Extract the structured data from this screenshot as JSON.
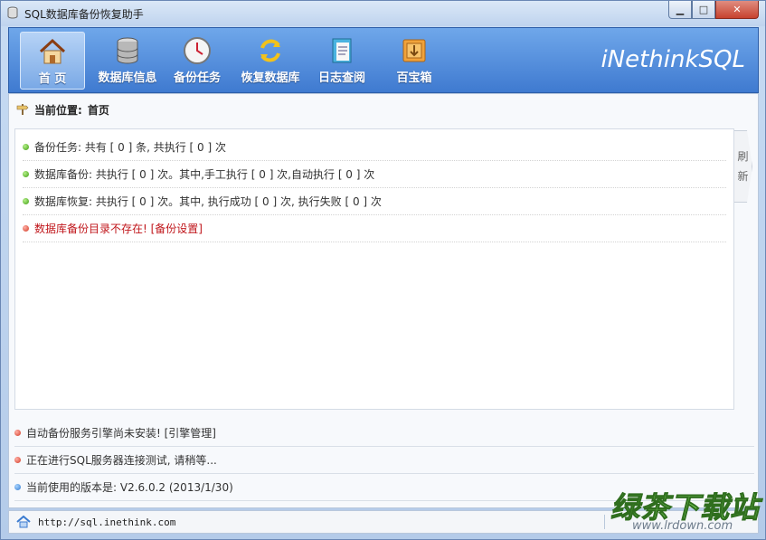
{
  "window": {
    "title": "SQL数据库备份恢复助手",
    "controls": {
      "minimize": "▁",
      "maximize": "□",
      "close": "✕"
    }
  },
  "toolbar": {
    "items": [
      {
        "label": "首 页",
        "icon": "home-icon",
        "active": true
      },
      {
        "label": "数据库信息",
        "icon": "database-icon",
        "active": false
      },
      {
        "label": "备份任务",
        "icon": "clock-icon",
        "active": false
      },
      {
        "label": "恢复数据库",
        "icon": "restore-icon",
        "active": false
      },
      {
        "label": "日志查阅",
        "icon": "log-book-icon",
        "active": false
      },
      {
        "label": "百宝箱",
        "icon": "toolbox-icon",
        "active": false
      }
    ],
    "brand": "iNethinkSQL"
  },
  "breadcrumb": {
    "prefix": "当前位置:",
    "current": "首页"
  },
  "summary": [
    {
      "text": "备份任务: 共有 [ 0 ] 条, 共执行 [ 0 ] 次",
      "status": "ok"
    },
    {
      "text": "数据库备份: 共执行 [ 0 ] 次。其中,手工执行 [ 0 ] 次,自动执行 [ 0 ] 次",
      "status": "ok"
    },
    {
      "text": "数据库恢复: 共执行 [ 0 ] 次。其中, 执行成功 [ 0 ] 次, 执行失败 [ 0 ] 次",
      "status": "ok"
    },
    {
      "text": "数据库备份目录不存在! [备份设置]",
      "status": "error"
    }
  ],
  "refresh": {
    "label_top": "刷",
    "label_bottom": "新"
  },
  "status_messages": [
    {
      "text": "自动备份服务引擎尚未安装! [引擎管理]",
      "status": "error"
    },
    {
      "text": "正在进行SQL服务器连接测试, 请稍等...",
      "status": "error"
    },
    {
      "text": "当前使用的版本是: V2.6.0.2 (2013/1/30)",
      "status": "info"
    }
  ],
  "footer": {
    "url": "http://sql.inethink.com"
  },
  "watermark": {
    "brand": "绿茶下载站",
    "url": "www.lrdown.com"
  },
  "colors": {
    "toolbar": "#4f8bdb",
    "error_text": "#c0161b",
    "ok_dot": "#3f9d12"
  }
}
